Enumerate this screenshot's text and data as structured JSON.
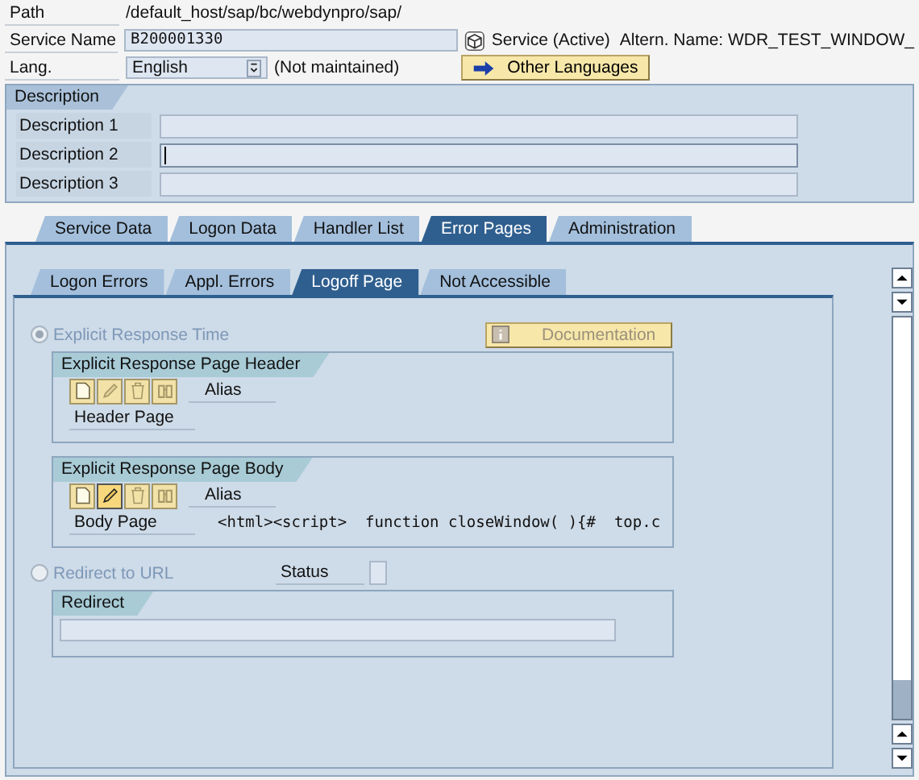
{
  "header_fields": [
    {
      "kind": "text",
      "label": "Path",
      "value": "/default_host/sap/bc/webdynpro/sap/"
    },
    {
      "kind": "service",
      "label": "Service Name",
      "value": "B200001330",
      "status": "Service (Active)",
      "alt_name": "Altern. Name: WDR_TEST_WINDOW_"
    },
    {
      "kind": "dropdown",
      "label": "Lang.",
      "value": "English",
      "note": "(Not maintained)",
      "button": "Other Languages"
    }
  ],
  "description": {
    "title": "Description",
    "rows": [
      {
        "label": "Description 1",
        "focused": false
      },
      {
        "label": "Description 2",
        "focused": true
      },
      {
        "label": "Description 3",
        "focused": false
      }
    ]
  },
  "tabs": [
    {
      "label": "Service Data",
      "selected": false
    },
    {
      "label": "Logon Data",
      "selected": false
    },
    {
      "label": "Handler List",
      "selected": false
    },
    {
      "label": "Error Pages",
      "selected": true
    },
    {
      "label": "Administration",
      "selected": false
    }
  ],
  "subtabs": [
    {
      "label": "Logon Errors",
      "selected": false
    },
    {
      "label": "Appl. Errors",
      "selected": false
    },
    {
      "label": "Logoff Page",
      "selected": true
    },
    {
      "label": "Not Accessible",
      "selected": false
    }
  ],
  "response_time": {
    "label": "Explicit Response Time",
    "selected": true,
    "disabled": true,
    "doc_button": "Documentation"
  },
  "header_group": {
    "title": "Explicit Response Page Header",
    "alias_label": "Alias",
    "page_label": "Header Page",
    "edit_active": false
  },
  "body_group": {
    "title": "Explicit Response Page Body",
    "alias_label": "Alias",
    "page_label": "Body Page",
    "page_value": "<html><script>  function closeWindow( ){#  top.c",
    "edit_active": true
  },
  "redirect_option": {
    "label": "Redirect to URL",
    "selected": false,
    "disabled": true,
    "status_label": "Status"
  },
  "redirect_group": {
    "title": "Redirect"
  }
}
